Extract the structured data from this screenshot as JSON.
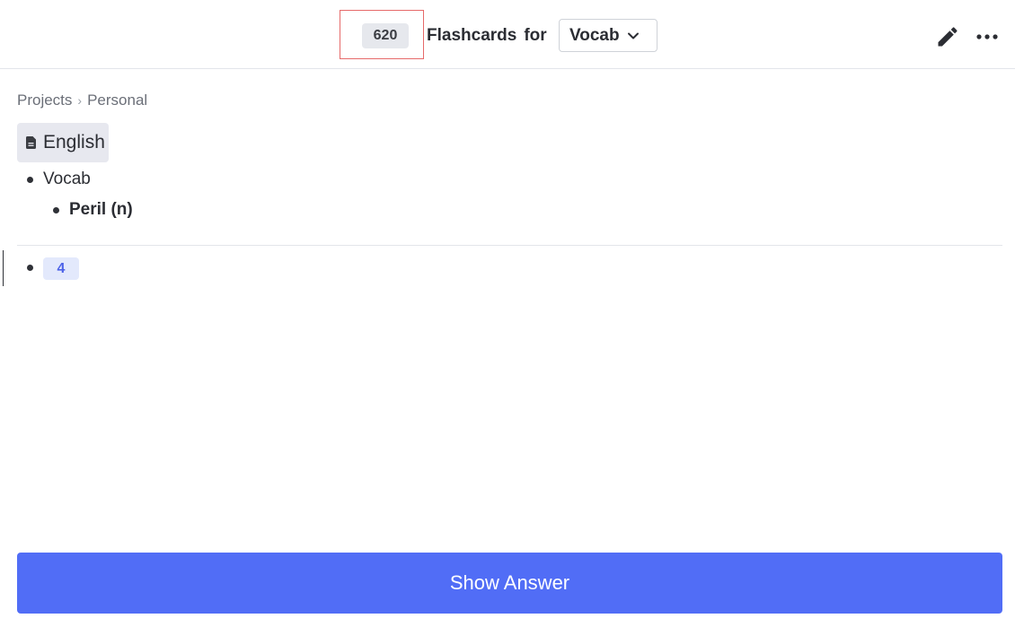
{
  "header": {
    "card_count": "620",
    "title": "Flashcards",
    "for_label": "for",
    "deck_selected": "Vocab",
    "icons": {
      "dropdown": "chevron-down-icon",
      "edit": "pencil-icon",
      "more": "more-horizontal-icon"
    }
  },
  "breadcrumb": {
    "items": [
      "Projects",
      "Personal"
    ]
  },
  "page": {
    "title": "English",
    "icon": "document-icon"
  },
  "outline": {
    "parent": "Vocab",
    "child": "Peril (n)",
    "answer_count": "4"
  },
  "actions": {
    "show_answer_label": "Show Answer"
  },
  "colors": {
    "accent": "#516df6",
    "badge_bg": "#e6e8ed",
    "answer_badge_bg": "#e3e9fc",
    "answer_badge_text": "#4d63e8",
    "highlight_border": "#e66a6a"
  }
}
